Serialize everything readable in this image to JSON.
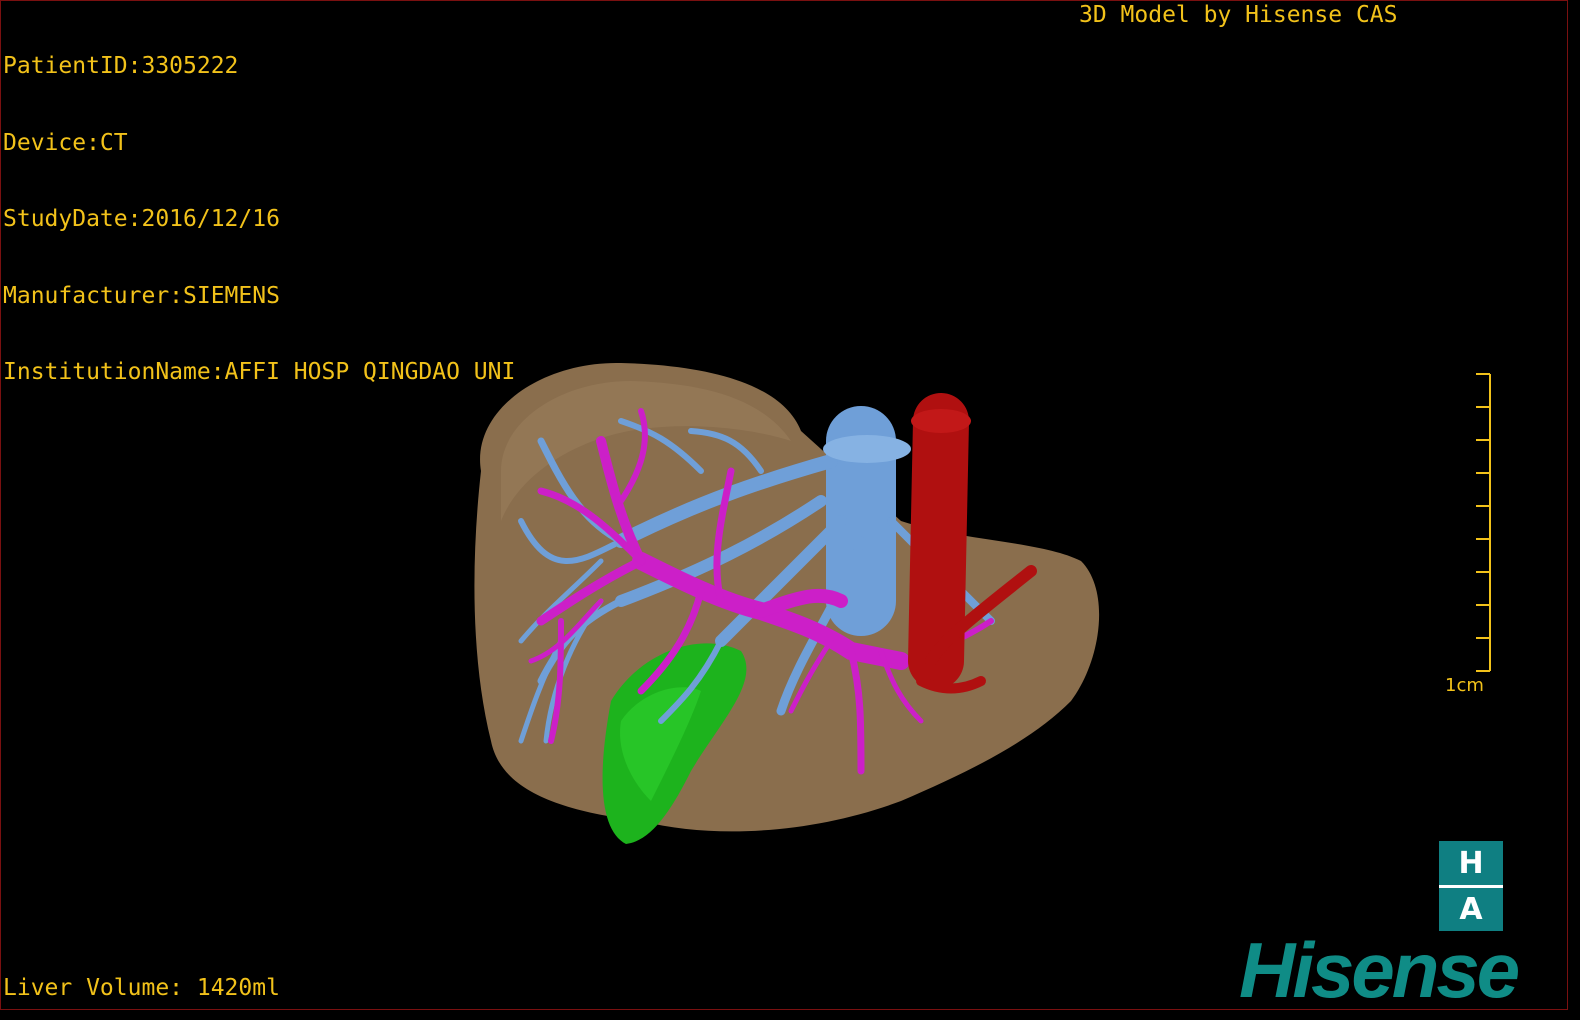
{
  "patient_info": {
    "patient_id": "PatientID:3305222",
    "device": "Device:CT",
    "study_date": "StudyDate:2016/12/16",
    "manufacturer": "Manufacturer:SIEMENS",
    "institution": "InstitutionName:AFFI HOSP QINGDAO UNI"
  },
  "brand_caption": "3D Model by Hisense CAS",
  "liver_volume": "Liver Volume: 1420ml",
  "scale": {
    "label": "1cm"
  },
  "logo": {
    "badge_top": "H",
    "badge_bottom": "A",
    "wordmark": "Hisense"
  },
  "colors": {
    "overlay_text": "#f2c21a",
    "liver": "#8a6e4d",
    "hepatic_vein": "#6f9fd8",
    "portal_vein": "#cc1fc8",
    "gallbladder": "#1db31d",
    "artery": "#b01010",
    "brand": "#0f8c86"
  }
}
